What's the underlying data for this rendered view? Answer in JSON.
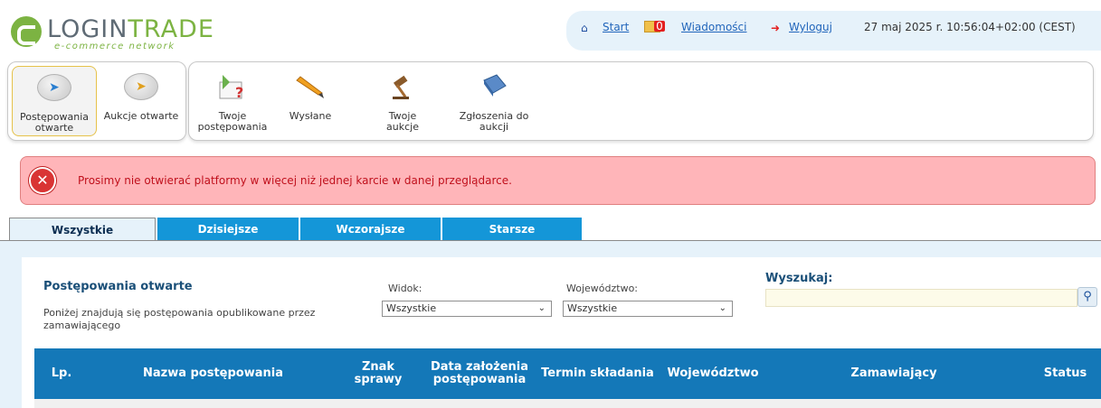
{
  "brand": {
    "name_part1": "LOGIN",
    "name_part2": "TRADE",
    "tagline": "e-commerce network"
  },
  "topbar": {
    "start_label": "Start",
    "messages_label": "Wiadomości",
    "messages_count": "0",
    "logout_label": "Wyloguj",
    "datetime": "27 maj 2025 r. 10:56:04+02:00 (CEST)"
  },
  "toolbar": {
    "left_items": [
      {
        "label": "Postępowania otwarte",
        "icon": "arrow-right-icon"
      },
      {
        "label": "Aukcje otwarte",
        "icon": "hammer-arrow-icon"
      }
    ],
    "right_items": [
      {
        "label": "Twoje postępowania",
        "icon": "envelope-question-icon"
      },
      {
        "label": "Wysłane",
        "icon": "pencil-icon"
      },
      {
        "label": "Twoje aukcje",
        "icon": "gavel-icon"
      },
      {
        "label": "Zgłoszenia do aukcji",
        "icon": "book-icon"
      }
    ]
  },
  "alert": {
    "message": "Prosimy nie otwierać platformy w więcej niż jednej karcie w danej przeglądarce."
  },
  "tabs": [
    {
      "label": "Wszystkie",
      "active": true
    },
    {
      "label": "Dzisiejsze",
      "active": false
    },
    {
      "label": "Wczorajsze",
      "active": false
    },
    {
      "label": "Starsze",
      "active": false
    }
  ],
  "section": {
    "title": "Postępowania otwarte",
    "description": "Poniżej znajdują się postępowania opublikowane przez zamawiającego"
  },
  "filters": {
    "view_label": "Widok:",
    "view_value": "Wszystkie",
    "region_label": "Województwo:",
    "region_value": "Wszystkie",
    "search_label": "Wyszukaj:",
    "search_value": ""
  },
  "table": {
    "columns": [
      "Lp.",
      "Nazwa postępowania",
      "Znak sprawy",
      "Data założenia postępowania",
      "Termin składania",
      "Województwo",
      "Zamawiający",
      "Status"
    ]
  },
  "colors": {
    "header_bg": "#1478b8",
    "tab_active_bg": "#e6f2fa",
    "tab_inactive_bg": "#1496d8",
    "alert_bg": "#ffb5b9",
    "alert_text": "#c0101c"
  }
}
